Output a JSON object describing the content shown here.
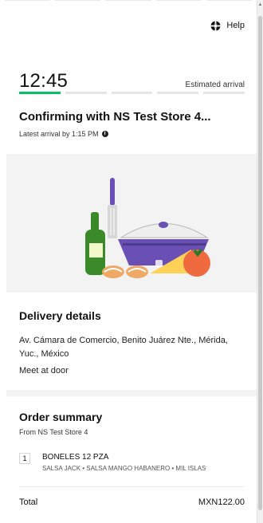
{
  "header": {
    "help_label": "Help"
  },
  "eta": {
    "time": "12:45",
    "label": "Estimated arrival",
    "progress_steps": 5,
    "active_step": 1,
    "accent_color": "#06c167"
  },
  "status": {
    "title": "Confirming with NS Test Store 4...",
    "latest_arrival": "Latest arrival by 1:15 PM"
  },
  "illustration": {
    "name": "cooking-ingredients-illustration"
  },
  "delivery": {
    "title": "Delivery details",
    "address": "Av. Cámara de Comercio, Benito Juárez Nte., Mérida, Yuc., México",
    "instructions": "Meet at door"
  },
  "order": {
    "title": "Order summary",
    "from": "From NS Test Store 4",
    "items": [
      {
        "quantity": "1",
        "name": "BONELES 12 PZA",
        "options": "SALSA JACK • SALSA MANGO HABANERO • MIL ISLAS"
      }
    ],
    "total_label": "Total",
    "total_value": "MXN122.00"
  },
  "icons": {
    "help": "help-icon",
    "info": "info-icon"
  }
}
